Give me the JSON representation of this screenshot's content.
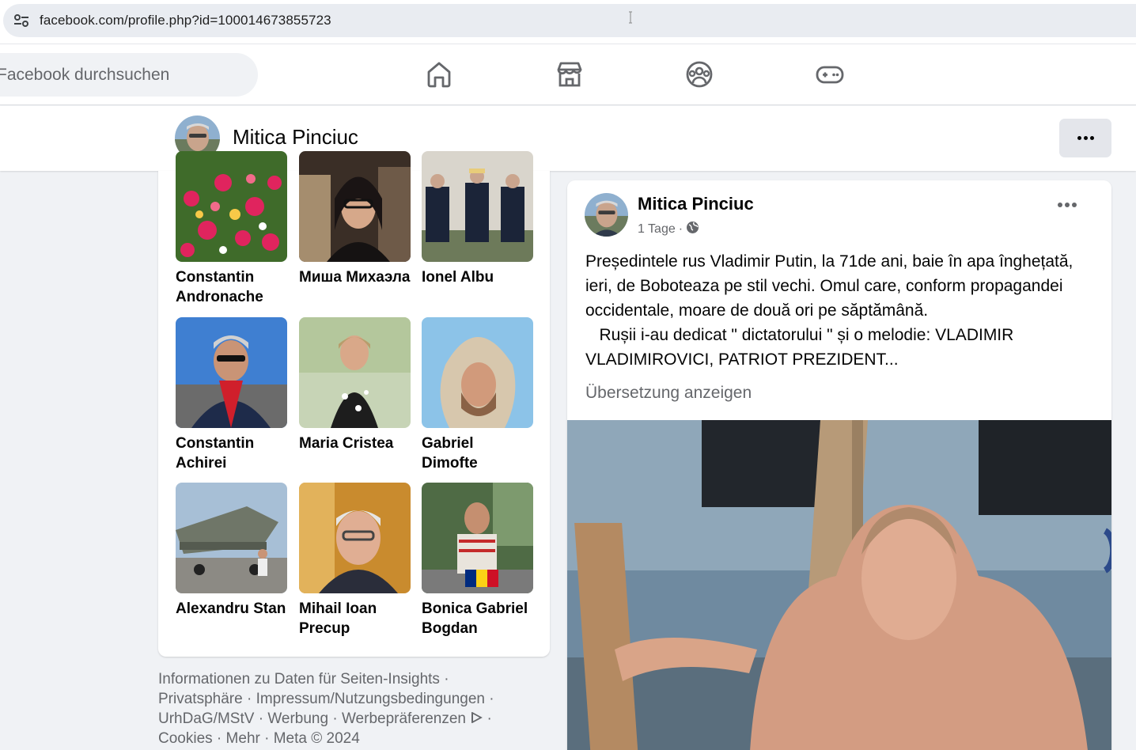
{
  "browser": {
    "url": "facebook.com/profile.php?id=100014673855723"
  },
  "header": {
    "search_placeholder": "Facebook durchsuchen",
    "nav": [
      "home-icon",
      "marketplace-icon",
      "groups-icon",
      "gaming-icon"
    ]
  },
  "profile": {
    "name": "Mitica Pinciuc"
  },
  "friends": [
    {
      "name": "Constantin Andronache"
    },
    {
      "name": "Миша Михаэла"
    },
    {
      "name": "Ionel Albu"
    },
    {
      "name": "Constantin Achirei"
    },
    {
      "name": "Maria Cristea"
    },
    {
      "name": "Gabriel Dimofte"
    },
    {
      "name": "Alexandru Stan"
    },
    {
      "name": "Mihail Ioan Precup"
    },
    {
      "name": "Bonica Gabriel Bogdan"
    }
  ],
  "footer": {
    "links": [
      "Informationen zu Daten für Seiten-Insights",
      "Privatsphäre",
      "Impressum/Nutzungsbedingungen",
      "UrhDaG/MStV",
      "Werbung",
      "Werbepräferenzen",
      "Cookies",
      "Mehr"
    ],
    "copyright": "Meta © 2024"
  },
  "post": {
    "author": "Mitica Pinciuc",
    "time": "1 Tage",
    "text_line1": "Președintele rus Vladimir Putin, la 71de ani, baie în apa înghețată, ieri, de Boboteaza pe stil vechi. Omul care, conform propagandei occidentale, moare de două ori pe săptămână.",
    "text_line2": "   Rușii i-au dedicat \" dictatorului \" și o melodie: VLADIMIR VLADIMIROVICI, PATRIOT PREZIDENT...",
    "translate_label": "Übersetzung anzeigen"
  }
}
